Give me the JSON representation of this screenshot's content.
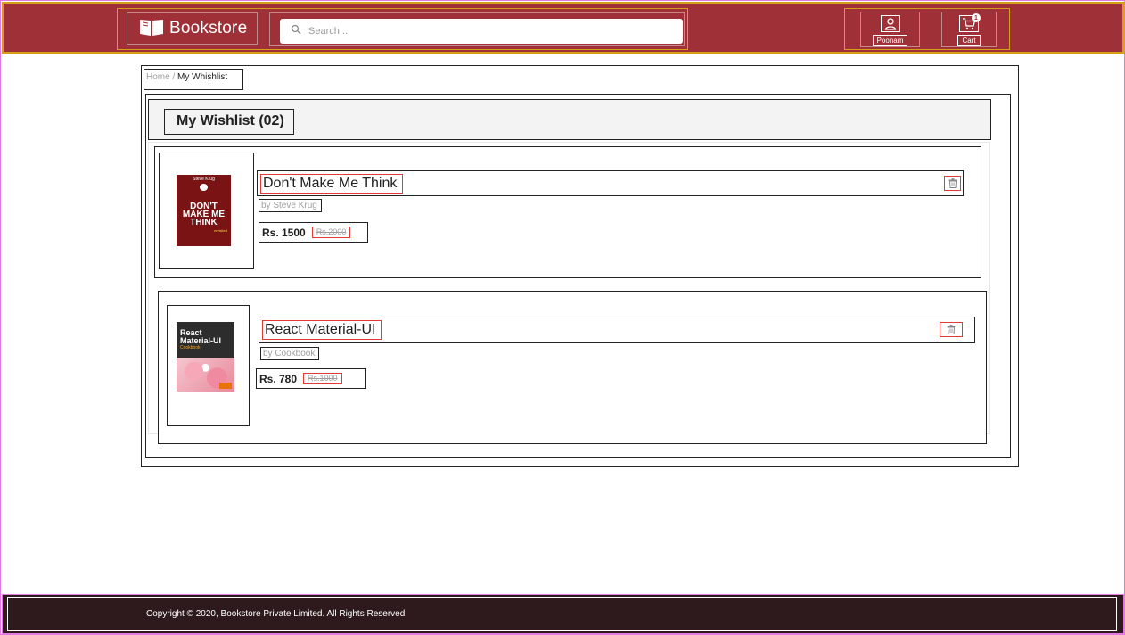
{
  "header": {
    "brand_name": "Bookstore",
    "search_placeholder": "Search ...",
    "profile_label": "Poonam",
    "cart_label": "Cart",
    "cart_count": "1",
    "colors": {
      "primary": "#a03037",
      "outline": "#d4a017"
    }
  },
  "breadcrumb": {
    "home": "Home",
    "separator": " / ",
    "current": "My Whishlist"
  },
  "wishlist": {
    "title": "My Wishlist (02)",
    "items": [
      {
        "title": "Don't Make Me Think",
        "author": "by Steve Krug",
        "price": "Rs. 1500",
        "old_price": "Rs.2000",
        "cover": {
          "author": "Steve Krug",
          "main": "DON'T MAKE ME THINK",
          "subtitle": "revisited"
        },
        "delete_icon": "trash-icon"
      },
      {
        "title": "React Material-UI",
        "author": "by Cookbook",
        "price": "Rs. 780",
        "old_price": "Rs.1000",
        "cover": {
          "main": "React Material-UI",
          "subtitle": "Cookbook"
        },
        "delete_icon": "trash-icon"
      }
    ]
  },
  "footer": {
    "copyright": "Copyright © 2020, Bookstore Private Limited. All Rights Reserved"
  }
}
